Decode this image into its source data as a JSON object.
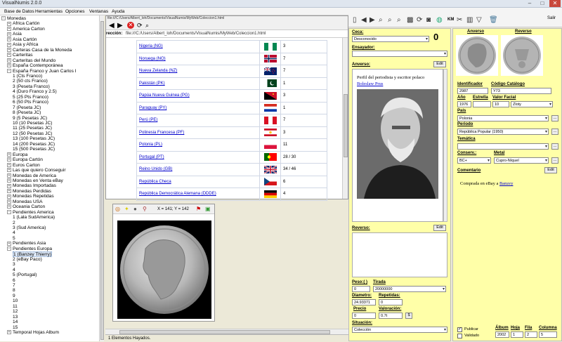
{
  "window": {
    "title": "VisualNumis 2.0.0",
    "min": "–",
    "max": "□",
    "close": "✕"
  },
  "menu": [
    "Base de Datos",
    "Herramientas",
    "Opciones",
    "Ventanas",
    "Ayuda"
  ],
  "tree": [
    {
      "t": "Monedas",
      "l": 0,
      "pm": "−"
    },
    {
      "t": "Africa Cartón",
      "l": 1,
      "pm": "+"
    },
    {
      "t": "America Carton",
      "l": 1,
      "pm": "+"
    },
    {
      "t": "Asia",
      "l": 1,
      "pm": "+"
    },
    {
      "t": "Asia Cartón",
      "l": 1,
      "pm": "+"
    },
    {
      "t": "Asia y Africa",
      "l": 1,
      "pm": "+"
    },
    {
      "t": "Carteras Casa de la Moneda",
      "l": 1,
      "pm": "+"
    },
    {
      "t": "Carteritas",
      "l": 1,
      "pm": "+"
    },
    {
      "t": "Carteritas del Mundo",
      "l": 1,
      "pm": "+"
    },
    {
      "t": "España Contemporánea",
      "l": 1,
      "pm": "+"
    },
    {
      "t": "España Franco y Juan Carlos I",
      "l": 1,
      "pm": "−"
    },
    {
      "t": "1 (Cts Franco)",
      "l": 2,
      "pm": ""
    },
    {
      "t": "2 (50 cts Franco)",
      "l": 2,
      "pm": ""
    },
    {
      "t": "3 (Peseta Franco)",
      "l": 2,
      "pm": ""
    },
    {
      "t": "4 (Duro Franco y 2.5)",
      "l": 2,
      "pm": ""
    },
    {
      "t": "5 (25 Pts Franco)",
      "l": 2,
      "pm": ""
    },
    {
      "t": "6 (50 Pts Franco)",
      "l": 2,
      "pm": ""
    },
    {
      "t": "7 (Peseta JC)",
      "l": 2,
      "pm": ""
    },
    {
      "t": "8 (Peseta JC)",
      "l": 2,
      "pm": ""
    },
    {
      "t": "9 (5 Pesetas JC)",
      "l": 2,
      "pm": ""
    },
    {
      "t": "10 (10 Pesetas JC)",
      "l": 2,
      "pm": ""
    },
    {
      "t": "11 (25 Pesetas JC)",
      "l": 2,
      "pm": ""
    },
    {
      "t": "12 (50 Pesetas JC)",
      "l": 2,
      "pm": ""
    },
    {
      "t": "13 (100 Pesetas JC)",
      "l": 2,
      "pm": ""
    },
    {
      "t": "14 (200 Pesetas JC)",
      "l": 2,
      "pm": ""
    },
    {
      "t": "15 (500 Pesetas JC)",
      "l": 2,
      "pm": ""
    },
    {
      "t": "Europa",
      "l": 1,
      "pm": "+"
    },
    {
      "t": "Europa Cartón",
      "l": 1,
      "pm": "+"
    },
    {
      "t": "Euros Carton",
      "l": 1,
      "pm": "+"
    },
    {
      "t": "Las que quiero Conseguir",
      "l": 1,
      "pm": "+"
    },
    {
      "t": "Monedas de America",
      "l": 1,
      "pm": "+"
    },
    {
      "t": "Monedas en Venta eBay",
      "l": 1,
      "pm": "+"
    },
    {
      "t": "Monedas Importadas",
      "l": 1,
      "pm": "+"
    },
    {
      "t": "Monedas Perdidas",
      "l": 1,
      "pm": "+"
    },
    {
      "t": "Monedas Repetidas",
      "l": 1,
      "pm": "+"
    },
    {
      "t": "Monedas USA",
      "l": 1,
      "pm": "+"
    },
    {
      "t": "Oceania Carton",
      "l": 1,
      "pm": "+"
    },
    {
      "t": "Pendientes America",
      "l": 1,
      "pm": "−"
    },
    {
      "t": "1 (Lala SudAmerica)",
      "l": 2,
      "pm": ""
    },
    {
      "t": "2",
      "l": 2,
      "pm": ""
    },
    {
      "t": "3 (Sud America)",
      "l": 2,
      "pm": ""
    },
    {
      "t": "4",
      "l": 2,
      "pm": ""
    },
    {
      "t": "5",
      "l": 2,
      "pm": ""
    },
    {
      "t": "Pendientes Asia",
      "l": 1,
      "pm": "+"
    },
    {
      "t": "Pendientes Europa",
      "l": 1,
      "pm": "−"
    },
    {
      "t": "1 (Banzey Thierry)",
      "l": 2,
      "pm": "",
      "sel": true
    },
    {
      "t": "2 (eBay Paco)",
      "l": 2,
      "pm": ""
    },
    {
      "t": "3",
      "l": 2,
      "pm": ""
    },
    {
      "t": "4",
      "l": 2,
      "pm": ""
    },
    {
      "t": "5 (Portugal)",
      "l": 2,
      "pm": ""
    },
    {
      "t": "6",
      "l": 2,
      "pm": ""
    },
    {
      "t": "7",
      "l": 2,
      "pm": ""
    },
    {
      "t": "8",
      "l": 2,
      "pm": ""
    },
    {
      "t": "9",
      "l": 2,
      "pm": ""
    },
    {
      "t": "10",
      "l": 2,
      "pm": ""
    },
    {
      "t": "11",
      "l": 2,
      "pm": ""
    },
    {
      "t": "12",
      "l": 2,
      "pm": ""
    },
    {
      "t": "13",
      "l": 2,
      "pm": ""
    },
    {
      "t": "14",
      "l": 2,
      "pm": ""
    },
    {
      "t": "15",
      "l": 2,
      "pm": ""
    },
    {
      "t": "Temporal Hojas Album",
      "l": 1,
      "pm": "+"
    }
  ],
  "browser": {
    "tab_path": "file:///C:/Users/Albert_loh/Documents/VisualNumis/MyWeb/Coleccion1.html",
    "url_label": "rección:",
    "url": "file:///C:/Users/Albert_loh/Documents/VisualNumis/MyWeb/Coleccion1.html",
    "rows": [
      {
        "name": "Nigeria (NG)",
        "flag": "ng",
        "count": "3"
      },
      {
        "name": "Noruega (NO)",
        "flag": "no",
        "count": "7"
      },
      {
        "name": "Nueva Zelanda (NZ)",
        "flag": "nz",
        "count": "7"
      },
      {
        "name": "Pakistán (PK)",
        "flag": "pk",
        "count": "1"
      },
      {
        "name": "Papúa Nueva Guinea (PG)",
        "flag": "pg",
        "count": "3"
      },
      {
        "name": "Paraguay (PY)",
        "flag": "py",
        "count": "1"
      },
      {
        "name": "Perú (PE)",
        "flag": "pe",
        "count": "7"
      },
      {
        "name": "Polinesia Francesa (PF)",
        "flag": "pf",
        "count": "3"
      },
      {
        "name": "Polonia (PL)",
        "flag": "pl",
        "count": "11"
      },
      {
        "name": "Portugal (PT)",
        "flag": "pt",
        "count": "28 / 30"
      },
      {
        "name": "Reino Unido (GB)",
        "flag": "gb",
        "count": "34 / 46"
      },
      {
        "name": "República Checa",
        "flag": "cz",
        "count": "6"
      },
      {
        "name": "República Democrática Alemana (DDDE)",
        "flag": "de",
        "count": "4"
      }
    ]
  },
  "viewer": {
    "coords": "X = 141; Y = 142"
  },
  "status": {
    "text": "1 Elementos Hayados."
  },
  "mid": {
    "ceca_label": "Ceca:",
    "ceca_value": "Desconocido",
    "ceca_num": "0",
    "ensayador_label": "Ensayador:",
    "anverso_label": "Anverso:",
    "edit1": "Edit",
    "anverso_desc": "Perfil del periodista y escritor polaco",
    "anverso_link": "Boleslaw Prus",
    "reverso_label": "Reverso:",
    "edit2": "Edit",
    "peso_label": "Peso:( )",
    "peso_value": "0",
    "tirada_label": "Tirada",
    "tirada_value": "20000000",
    "diametro_label": "Diametro:",
    "diametro_value": "24.93371",
    "repetidas_label": "Repetidas:",
    "repetidas_value": "0",
    "precio_label": "Precio",
    "precio_value": "0",
    "valoracion_label": "Valoración:",
    "valoracion_value": "0.7t",
    "dollar_btn": "$",
    "situacion_label": "Situación:",
    "situacion_value": "Colección"
  },
  "right": {
    "salir": "Salir",
    "anverso_img_label": "Anverso",
    "reverso_img_label": "Reverso",
    "identificador_label": "Identificador",
    "identificador_value": "2987",
    "codigo_label": "Código Catálogo",
    "codigo_value": "Y73",
    "ano_label": "Año",
    "ano_value": "1976",
    "estrella_label": "Estrella",
    "estrella_value": "",
    "valor_label": "Valor Facial",
    "valor_value": "10",
    "valor_unit": "Zloty",
    "pais_label": "País",
    "pais_value": "Polonia",
    "periodo_label": "Periodo",
    "periodo_value": "República Popular (1950)",
    "tematica_label": "Temática",
    "tematica_value": "",
    "conserv_label": "Conserv.:",
    "conserv_value": "BC+",
    "metal_label": "Metal",
    "metal_value": "Cupro-Níquel",
    "comentario_label": "Comentario",
    "edit3": "Edit",
    "comentario_text": "Comprada en eBay a ",
    "comentario_link": "Banzey",
    "publicar": "Publicar",
    "validado": "Validado",
    "album_label": "Álbum",
    "album_value": "2002",
    "hoja_label": "Hoja",
    "hoja_value": "1",
    "fila_label": "Fila",
    "fila_value": "2",
    "columna_label": "Columna",
    "columna_value": "5",
    "more_btn": "..."
  },
  "icons": {
    "km": "KM"
  }
}
